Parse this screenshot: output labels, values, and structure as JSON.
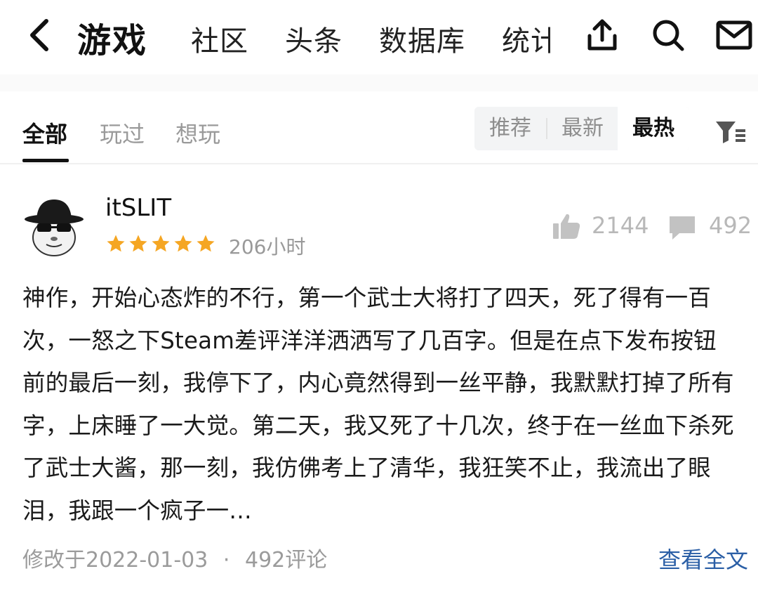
{
  "header": {
    "title": "游戏",
    "tabs": [
      "社区",
      "头条",
      "数据库",
      "统计"
    ],
    "icons": [
      "back-arrow-icon",
      "share-icon",
      "search-icon",
      "mail-icon"
    ]
  },
  "filters": {
    "tabs": [
      "全部",
      "玩过",
      "想玩"
    ],
    "active_tab": "全部",
    "sort": [
      "推荐",
      "最新",
      "最热"
    ],
    "active_sort": "最热",
    "filter_icon": "filter-icon"
  },
  "post": {
    "username": "itSLIT",
    "rating": 5,
    "rating_max": 5,
    "star_color": "#f5a623",
    "playtime": "206小时",
    "likes": "2144",
    "comments": "492",
    "body": "神作，开始心态炸的不行，第一个武士大将打了四天，死了得有一百次，一怒之下Steam差评洋洋洒洒写了几百字。但是在点下发布按钮前的最后一刻，我停下了，内心竟然得到一丝平静，我默默打掉了所有字，上床睡了一大觉。第二天，我又死了十几次，终于在一丝血下杀死了武士大酱，那一刻，我仿佛考上了清华，我狂笑不止，我流出了眼泪，我跟一个疯子一…",
    "edited": "修改于2022-01-03",
    "separator": "·",
    "comment_count_text": "492评论",
    "read_more": "查看全文"
  },
  "colors": {
    "link": "#2b5fa6",
    "muted": "#9b9b9b",
    "text": "#111111"
  }
}
